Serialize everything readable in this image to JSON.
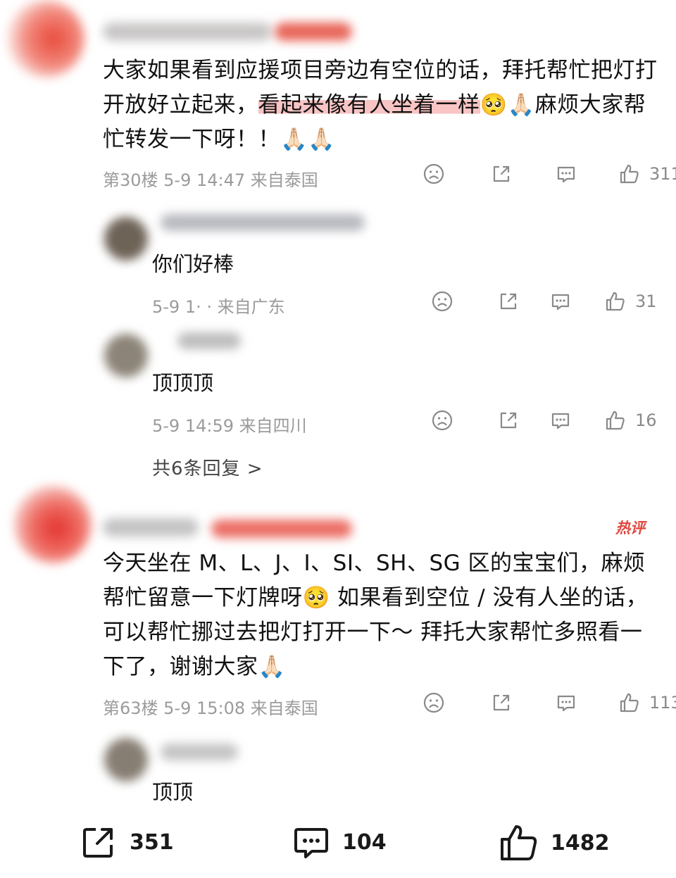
{
  "comments": [
    {
      "body_parts": {
        "pre": "大家如果看到应援项目旁边有空位的话，拜托帮忙把灯打开放好立起来，",
        "highlight": "看起来像有人坐着一样",
        "post": "🥺🙏🏻麻烦大家帮忙转发一下呀！！🙏🏻🙏🏻"
      },
      "meta": "第30楼 5-9 14:47 来自泰国",
      "likes": "311"
    },
    {
      "tag": "热评",
      "body": "今天坐在 M、L、J、I、SI、SH、SG 区的宝宝们，麻烦帮忙留意一下灯牌呀🥺 如果看到空位 / 没有人坐的话，可以帮忙挪过去把灯打开一下～ 拜托大家帮忙多照看一下了，谢谢大家🙏🏻",
      "meta": "第63楼 5-9 15:08 来自泰国",
      "likes": "113"
    }
  ],
  "replies": [
    {
      "text": "你们好棒",
      "meta": "5-9 1· ·   来自广东",
      "likes": "31"
    },
    {
      "text": "顶顶顶",
      "meta": "5-9 14:59 来自四川",
      "likes": "16"
    },
    {
      "text": "顶顶"
    }
  ],
  "more_replies": "共6条回复 >",
  "bottom_bar": {
    "share_count": "351",
    "comment_count": "104",
    "like_count": "1482"
  }
}
